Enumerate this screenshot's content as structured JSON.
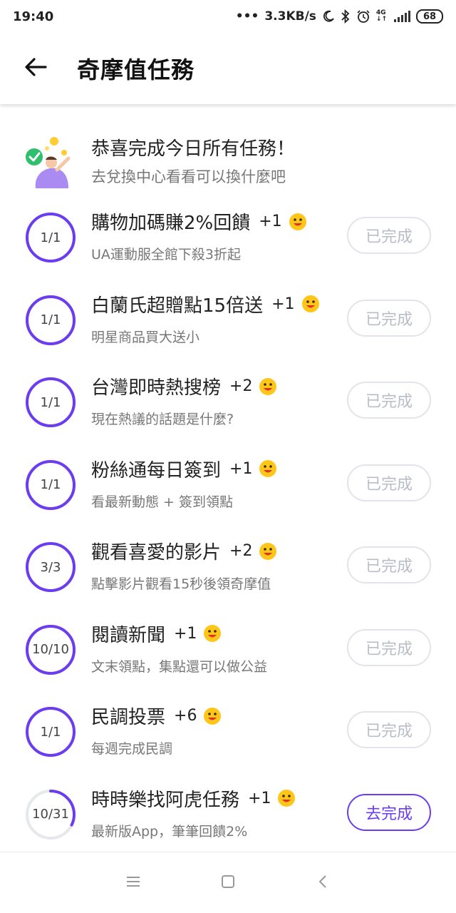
{
  "status_bar": {
    "time": "19:40",
    "speed": "3.3KB/s",
    "network": "4G",
    "battery": "68"
  },
  "header": {
    "title": "奇摩值任務"
  },
  "congrats": {
    "title": "恭喜完成今日所有任務！",
    "subtitle": "去兌換中心看看可以換什麼吧"
  },
  "colors": {
    "accent": "#6c3df0",
    "ring_track": "#e6e8ec",
    "done_button": "#b9bdc7"
  },
  "tasks": [
    {
      "title": "購物加碼賺2%回饋",
      "points": "+1",
      "subtitle": "UA運動服全館下殺3折起",
      "progress_label": "1/1",
      "progress": 1.0,
      "button": "已完成",
      "done": true
    },
    {
      "title": "白蘭氏超贈點15倍送",
      "points": "+1",
      "subtitle": "明星商品買大送小",
      "progress_label": "1/1",
      "progress": 1.0,
      "button": "已完成",
      "done": true
    },
    {
      "title": "台灣即時熱搜榜",
      "points": "+2",
      "subtitle": "現在熱議的話題是什麼?",
      "progress_label": "1/1",
      "progress": 1.0,
      "button": "已完成",
      "done": true
    },
    {
      "title": "粉絲通每日簽到",
      "points": "+1",
      "subtitle": "看最新動態 + 簽到領點",
      "progress_label": "1/1",
      "progress": 1.0,
      "button": "已完成",
      "done": true
    },
    {
      "title": "觀看喜愛的影片",
      "points": "+2",
      "subtitle": "點擊影片觀看15秒後領奇摩值",
      "progress_label": "3/3",
      "progress": 1.0,
      "button": "已完成",
      "done": true
    },
    {
      "title": "閱讀新聞",
      "points": "+1",
      "subtitle": "文末領點，集點還可以做公益",
      "progress_label": "10/10",
      "progress": 1.0,
      "button": "已完成",
      "done": true
    },
    {
      "title": "民調投票",
      "points": "+6",
      "subtitle": "每週完成民調",
      "progress_label": "1/1",
      "progress": 1.0,
      "button": "已完成",
      "done": true
    },
    {
      "title": "時時樂找阿虎任務",
      "points": "+1",
      "subtitle": "最新版App，筆筆回饋2%",
      "progress_label": "10/31",
      "progress": 0.3226,
      "button": "去完成",
      "done": false
    }
  ],
  "icons": {
    "back": "arrow-left-icon",
    "coin": "smiley-coin-icon",
    "nav": [
      "menu-icon",
      "home-square-icon",
      "back-chevron-icon"
    ]
  }
}
